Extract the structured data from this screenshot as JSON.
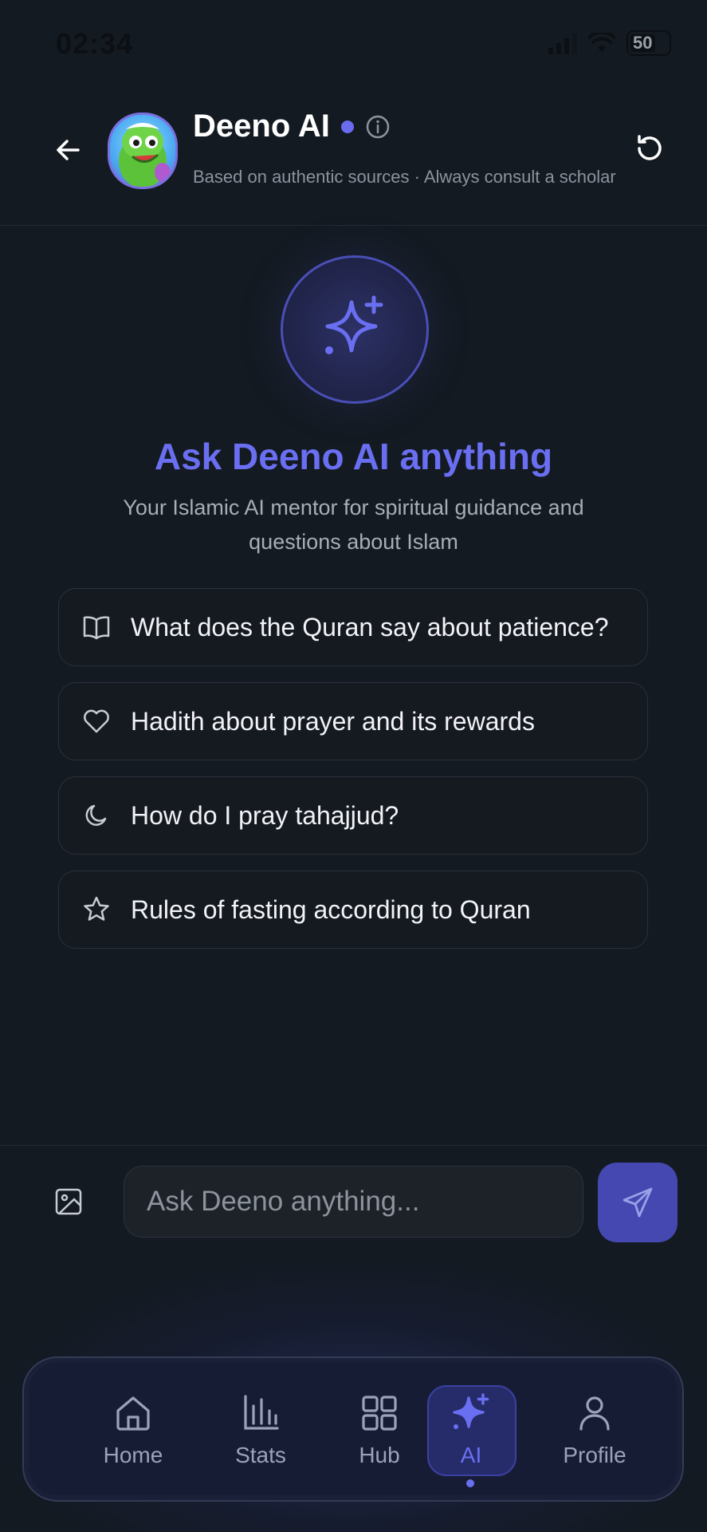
{
  "status_bar": {
    "time": "02:34",
    "battery": "50"
  },
  "header": {
    "title": "Deeno AI",
    "subtitle": "Based on authentic sources · Always consult a scholar",
    "online_color": "#6a6cf0"
  },
  "hero": {
    "title": "Ask Deeno AI anything",
    "subtitle": "Your Islamic AI mentor for spiritual guidance and questions about Islam",
    "accent": "#6a6ff2"
  },
  "suggestions": [
    {
      "icon": "book-open-icon",
      "text": "What does the Quran say about patience?"
    },
    {
      "icon": "heart-icon",
      "text": "Hadith about prayer and its rewards"
    },
    {
      "icon": "moon-icon",
      "text": "How do I pray tahajjud?"
    },
    {
      "icon": "star-icon",
      "text": "Rules of fasting according to Quran"
    }
  ],
  "composer": {
    "placeholder": "Ask Deeno anything...",
    "send_color": "#4448b0"
  },
  "nav": {
    "active": "AI",
    "items": [
      {
        "icon": "home-icon",
        "label": "Home"
      },
      {
        "icon": "bar-chart-icon",
        "label": "Stats"
      },
      {
        "icon": "grid-icon",
        "label": "Hub"
      },
      {
        "icon": "sparkles-icon",
        "label": "AI"
      },
      {
        "icon": "user-icon",
        "label": "Profile"
      }
    ]
  }
}
